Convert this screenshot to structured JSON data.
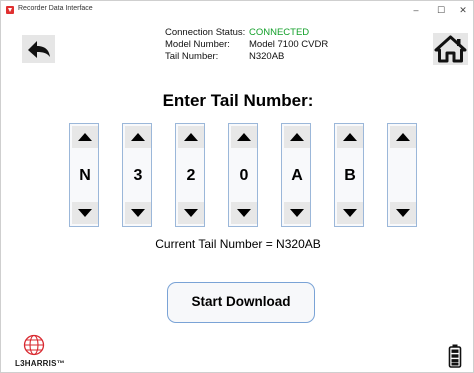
{
  "window": {
    "title": "Recorder Data Interface",
    "min_glyph": "–",
    "max_glyph": "☐",
    "close_glyph": "✕"
  },
  "status": {
    "connection_label": "Connection Status:",
    "connection_value": "CONNECTED",
    "model_label": "Model Number:",
    "model_value": "Model 7100 CVDR",
    "tail_label": "Tail Number:",
    "tail_value": "N320AB"
  },
  "heading": "Enter Tail Number:",
  "digits": [
    "N",
    "3",
    "2",
    "0",
    "A",
    "B",
    ""
  ],
  "current_tail_text": "Current Tail Number = N320AB",
  "download_label": "Start Download",
  "logo": {
    "text": "L3HARRIS™"
  },
  "icons": {
    "back": "back-arrow-icon",
    "home": "home-icon",
    "battery": "battery-icon"
  },
  "colors": {
    "connected": "#13a02a",
    "accent_border": "#7aa3d6",
    "logo_red": "#d8282f"
  }
}
